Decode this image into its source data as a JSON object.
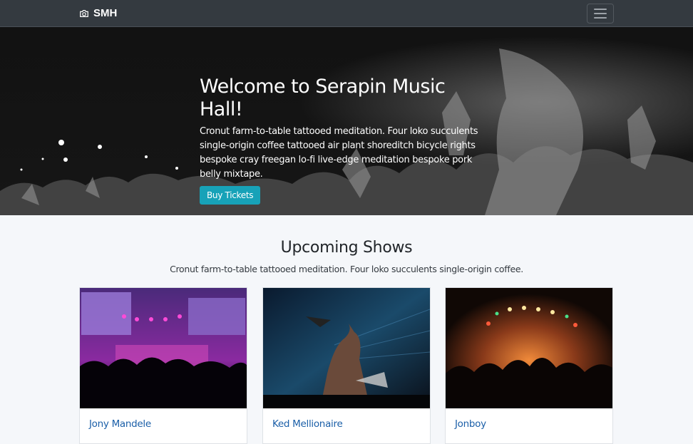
{
  "navbar": {
    "brand": "SMH",
    "brand_icon": "camera-icon",
    "toggle_icon": "hamburger-menu-icon"
  },
  "hero": {
    "title": "Welcome to Serapin Music Hall!",
    "text": "Cronut farm-to-table tattooed meditation. Four loko succulents single-origin coffee tattooed air plant shoreditch bicycle rights bespoke cray freegan lo-fi live-edge meditation bespoke pork belly mixtape.",
    "button_label": "Buy Tickets"
  },
  "shows": {
    "title": "Upcoming Shows",
    "subtitle": "Cronut farm-to-table tattooed meditation. Four loko succulents single-origin coffee.",
    "cards": [
      {
        "title": "Jony Mandele"
      },
      {
        "title": "Ked Mellionaire"
      },
      {
        "title": "Jonboy"
      }
    ]
  },
  "colors": {
    "navbar_bg": "#343a40",
    "button_bg": "#17a2b8",
    "link": "#1b5fa8"
  }
}
